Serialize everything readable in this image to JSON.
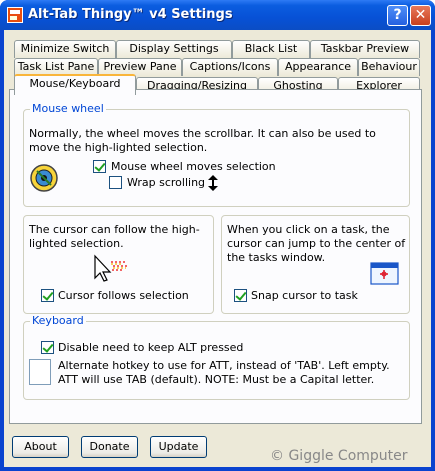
{
  "window": {
    "title": "Alt-Tab Thingy™ v4 Settings",
    "help_glyph": "?",
    "close_glyph": "✕"
  },
  "tabs": [
    {
      "label": "Minimize Switch"
    },
    {
      "label": "Display Settings"
    },
    {
      "label": "Black List"
    },
    {
      "label": "Taskbar Preview"
    },
    {
      "label": "Task List Pane"
    },
    {
      "label": "Preview Pane"
    },
    {
      "label": "Captions/Icons"
    },
    {
      "label": "Appearance"
    },
    {
      "label": "Behaviour"
    },
    {
      "label": "Mouse/Keyboard",
      "active": true
    },
    {
      "label": "Dragging/Resizing"
    },
    {
      "label": "Ghosting"
    },
    {
      "label": "Explorer"
    }
  ],
  "mouse_wheel": {
    "label": "Mouse wheel",
    "description": "Normally, the wheel moves the scrollbar. It can also be used to move the high-lighted selection.",
    "moves_selection": {
      "label": "Mouse wheel moves selection",
      "checked": true
    },
    "wrap_scrolling": {
      "label": "Wrap scrolling",
      "checked": false
    }
  },
  "cursor_follow": {
    "description": "The cursor can follow the high-lighted selection.",
    "follows_selection": {
      "label": "Cursor follows selection",
      "checked": true
    }
  },
  "cursor_snap": {
    "description": "When you click on a task, the cursor can jump to the center of the tasks window.",
    "snap_cursor": {
      "label": "Snap cursor to task",
      "checked": true
    }
  },
  "keyboard": {
    "label": "Keyboard",
    "disable_alt": {
      "label": "Disable need to keep ALT pressed",
      "checked": true
    },
    "hotkey_description": "Alternate hotkey to use for ATT, instead of 'TAB'.  Left empty. ATT will use TAB (default).  NOTE: Must be a Capital letter.",
    "hotkey_value": ""
  },
  "buttons": {
    "about": "About",
    "donate": "Donate",
    "update": "Update"
  },
  "watermark": "© Giggle Computer"
}
